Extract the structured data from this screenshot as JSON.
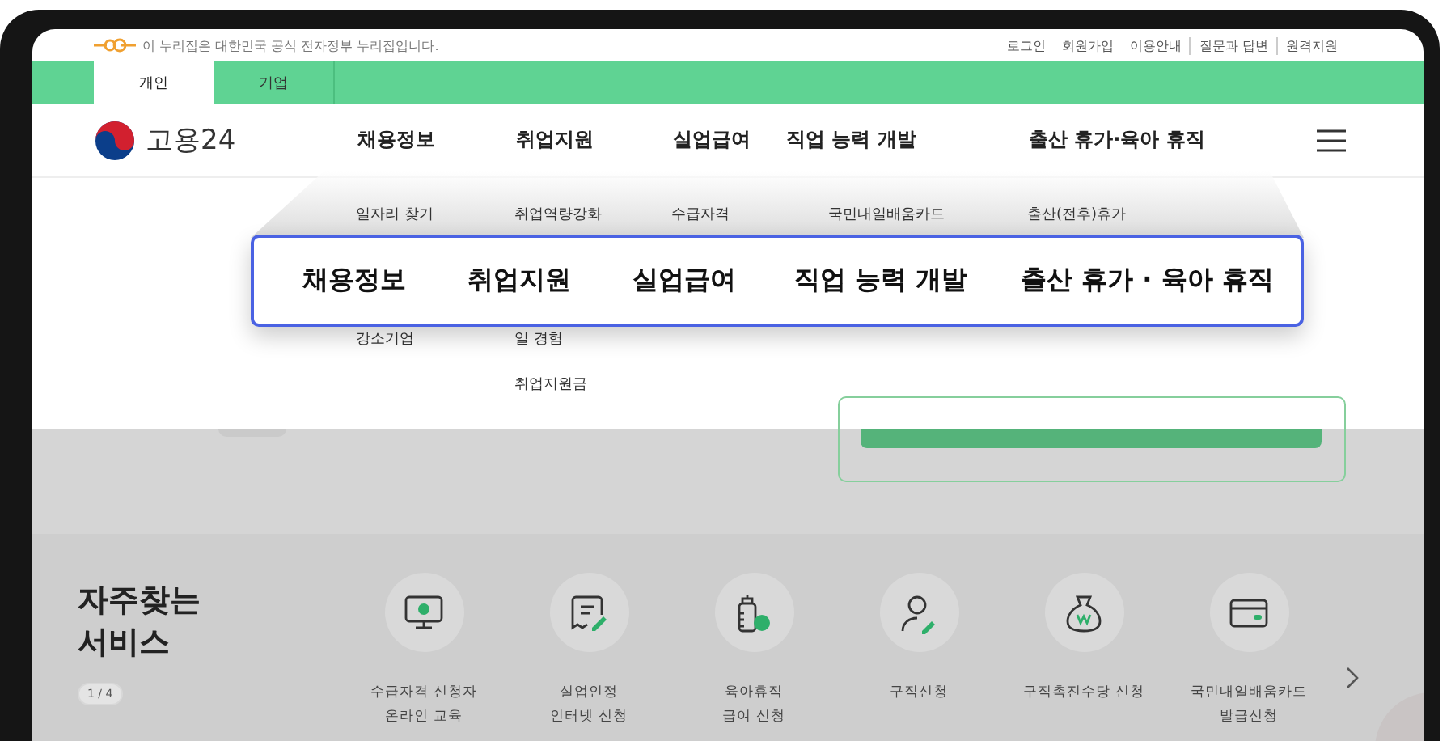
{
  "notice": "이 누리집은 대한민국 공식 전자정부 누리집입니다.",
  "utility_links": [
    {
      "label": "로그인"
    },
    {
      "label": "회원가입"
    },
    {
      "label": "이용안내"
    },
    {
      "label": "질문과 답변"
    },
    {
      "label": "원격지원"
    }
  ],
  "user_tabs": [
    {
      "label": "개인",
      "selected": true
    },
    {
      "label": "기업",
      "selected": false
    }
  ],
  "logo": "고용24",
  "nav": [
    "채용정보",
    "취업지원",
    "실업급여",
    "직업 능력 개발",
    "출산 휴가·육아 휴직"
  ],
  "menu_columns": [
    {
      "top": "일자리 찾기",
      "bottom": [
        "강소기업"
      ]
    },
    {
      "top": "취업역량강화",
      "bottom": [
        "일 경험",
        "취업지원금"
      ]
    },
    {
      "top": "수급자격"
    },
    {
      "top": "국민내일배움카드"
    },
    {
      "top": "출산(전후)휴가"
    }
  ],
  "callout": [
    "채용정보",
    "취업지원",
    "실업급여",
    "직업 능력 개발",
    "출산 휴가 · 육아 휴직"
  ],
  "services": {
    "title": [
      "자주찾는",
      "서비스"
    ],
    "pager": "1 / 4",
    "items": [
      {
        "kind": "monitor",
        "lines": [
          "수급자격 신청자",
          "온라인 교육"
        ]
      },
      {
        "kind": "document",
        "lines": [
          "실업인정",
          "인터넷 신청"
        ]
      },
      {
        "kind": "bottle",
        "lines": [
          "육아휴직",
          "급여 신청"
        ]
      },
      {
        "kind": "person",
        "lines": [
          "구직신청"
        ]
      },
      {
        "kind": "moneybag",
        "lines": [
          "구직촉진수당 신청"
        ]
      },
      {
        "kind": "card",
        "lines": [
          "국민내일배움카드",
          "발급신청"
        ]
      }
    ]
  }
}
